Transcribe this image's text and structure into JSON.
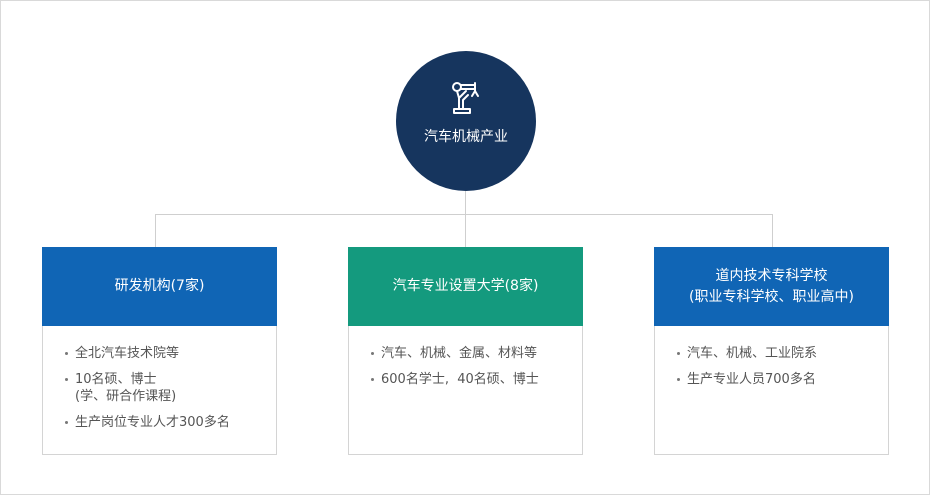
{
  "hub": {
    "title": "汽车机械产业",
    "icon": "robot-arm-icon",
    "color": "#16355e"
  },
  "cards": [
    {
      "title_lines": [
        "研发机构(7家)"
      ],
      "color": "#1065b5",
      "items": [
        "全北汽车技术院等",
        "10名硕、博士\n(学、研合作课程)",
        "生产岗位专业人才300多名"
      ]
    },
    {
      "title_lines": [
        "汽车专业设置大学(8家)"
      ],
      "color": "#149a7e",
      "items": [
        "汽车、机械、金属、材料等",
        "600名学士,  40名硕、博士"
      ]
    },
    {
      "title_lines": [
        "道内技术专科学校",
        "(职业专科学校、职业高中)"
      ],
      "color": "#1065b5",
      "items": [
        "汽车、机械、工业院系",
        "生产专业人员700多名"
      ]
    }
  ]
}
